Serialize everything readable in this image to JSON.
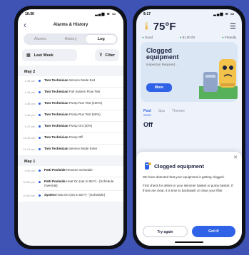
{
  "left": {
    "status_time": "10:30",
    "status_icons": "▂▄▆ ≋ ▭",
    "title": "Alarms & History",
    "tabs": [
      "Alarms",
      "History",
      "Log"
    ],
    "active_tab": "Log",
    "range_label": "Last Week",
    "filter_label": "Filter",
    "groups": [
      {
        "date": "May 2",
        "entries": [
          {
            "time": "1:45 pm",
            "actor": "Tom Technician",
            "action": "Service Mode Exit"
          },
          {
            "time": "1:45 pm",
            "actor": "Tom Technician",
            "action": "Full System Flow Test"
          },
          {
            "time": "1:45 pm",
            "actor": "Tom Technician",
            "action": "Pump Run Test (100%)"
          },
          {
            "time": "1:45 pm",
            "actor": "Tom Technician",
            "action": "Pump Run Test (50%)"
          },
          {
            "time": "1:47 pm",
            "actor": "Tom Technician",
            "action": "Pump On (30%)"
          },
          {
            "time": "11:45 am",
            "actor": "Tom Technician",
            "action": "Pump Off"
          },
          {
            "time": "11:15 am",
            "actor": "Tom Technician",
            "action": "Service Mode Enter"
          }
        ]
      },
      {
        "date": "May 1",
        "entries": [
          {
            "time": "4:00 pm",
            "actor": "Patti Poolside",
            "action": "Resume Schedule"
          },
          {
            "time": "10:50 pm",
            "actor": "Patti Poolside",
            "action": "Heat On (set to 86 F) - [Schedule Override]"
          },
          {
            "time": "10:00 am",
            "actor": "System",
            "action": "Heat On (set to 82 F) - [Schedule]"
          }
        ]
      }
    ]
  },
  "right": {
    "status_time": "9:17",
    "status_icons": "▂▄▆ ≋ ▭",
    "temperature": "75°F",
    "chips": [
      "Good",
      "$1.00 /hr",
      "Friendly"
    ],
    "card_title_line1": "Clogged",
    "card_title_line2": "equipment",
    "card_subtitle": "Inspection Required...",
    "more_label": "More",
    "tabs": [
      "Pool",
      "Spa",
      "Themes"
    ],
    "mode_label": "Off",
    "sheet_title": "Clogged equipment",
    "sheet_body_1": "We have detected that your equipment is getting clogged.",
    "sheet_body_2": "First check for debris in your skimmer basket or pump basket. If those are clear, it is time to backwash or clean your filter.",
    "btn_secondary": "Try again",
    "btn_primary": "Got it!",
    "close_glyph": "✕"
  },
  "icons": {
    "back": "‹",
    "calendar": "▦",
    "filter": "⊽",
    "thermometer": "🌡",
    "menu": "☰"
  },
  "colors": {
    "background": "#3f53b5",
    "accent": "#2f62e6",
    "timeline_dot": "#2d5be3",
    "warning": "#f0a818"
  }
}
